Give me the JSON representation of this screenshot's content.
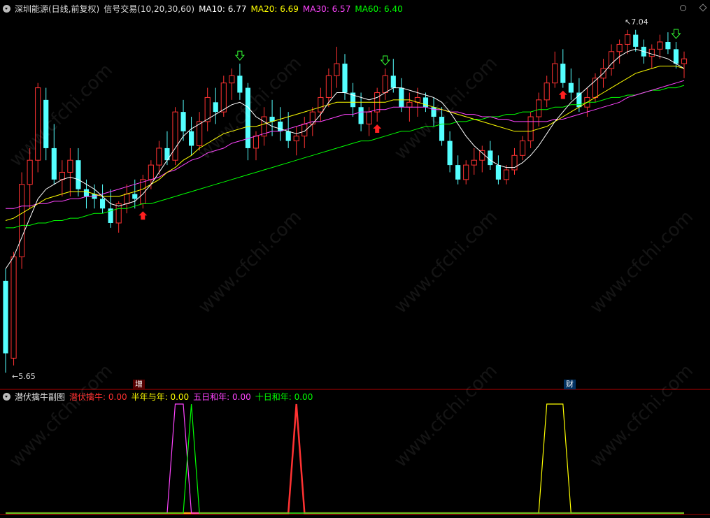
{
  "header": {
    "stock": "深圳能源(日线,前复权)",
    "indicator": "信号交易(10,20,30,60)",
    "ma": [
      {
        "label": "MA10: 6.77",
        "color": "#ffffff"
      },
      {
        "label": "MA20: 6.69",
        "color": "#ffff00"
      },
      {
        "label": "MA30: 6.57",
        "color": "#ff44ff"
      },
      {
        "label": "MA60: 6.40",
        "color": "#00ff00"
      }
    ]
  },
  "sub_header": {
    "name": "潜伏擒牛副图",
    "items": [
      {
        "label": "潜伏擒牛: 0.00",
        "color": "#ff3030"
      },
      {
        "label": "半年与年: 0.00",
        "color": "#ffff00"
      },
      {
        "label": "五日和年: 0.00",
        "color": "#ff44ff"
      },
      {
        "label": "十日和年: 0.00",
        "color": "#00ff00"
      }
    ]
  },
  "markers": {
    "high": "7.04",
    "low": "5.65",
    "tag_zeng": "增",
    "tag_cai": "财"
  },
  "watermark": "www.cfchi.com",
  "colors": {
    "up": "#ff3232",
    "down": "#54ffff",
    "ma10": "#ffffff",
    "ma20": "#ffff00",
    "ma30": "#ff44ff",
    "ma60": "#00ff00",
    "axis": "#b00000"
  },
  "chart_data": [
    {
      "type": "candlestick",
      "ylim": [
        5.6,
        7.1
      ],
      "candles": [
        [
          6.0,
          6.05,
          5.62,
          5.7
        ],
        [
          5.68,
          6.12,
          5.65,
          6.1
        ],
        [
          6.1,
          6.45,
          6.05,
          6.4
        ],
        [
          6.4,
          6.55,
          6.3,
          6.5
        ],
        [
          6.5,
          6.82,
          6.45,
          6.8
        ],
        [
          6.75,
          6.8,
          6.5,
          6.55
        ],
        [
          6.55,
          6.65,
          6.4,
          6.42
        ],
        [
          6.42,
          6.5,
          6.35,
          6.45
        ],
        [
          6.45,
          6.55,
          6.35,
          6.5
        ],
        [
          6.5,
          6.55,
          6.35,
          6.38
        ],
        [
          6.38,
          6.42,
          6.3,
          6.35
        ],
        [
          6.36,
          6.4,
          6.3,
          6.34
        ],
        [
          6.34,
          6.4,
          6.28,
          6.3
        ],
        [
          6.3,
          6.38,
          6.22,
          6.24
        ],
        [
          6.24,
          6.33,
          6.2,
          6.32
        ],
        [
          6.32,
          6.4,
          6.28,
          6.36
        ],
        [
          6.36,
          6.42,
          6.3,
          6.34
        ],
        [
          6.32,
          6.44,
          6.3,
          6.42
        ],
        [
          6.42,
          6.5,
          6.38,
          6.48
        ],
        [
          6.48,
          6.58,
          6.44,
          6.55
        ],
        [
          6.55,
          6.62,
          6.48,
          6.5
        ],
        [
          6.5,
          6.72,
          6.48,
          6.7
        ],
        [
          6.7,
          6.75,
          6.58,
          6.62
        ],
        [
          6.62,
          6.68,
          6.52,
          6.56
        ],
        [
          6.56,
          6.7,
          6.54,
          6.66
        ],
        [
          6.66,
          6.8,
          6.62,
          6.76
        ],
        [
          6.74,
          6.8,
          6.65,
          6.7
        ],
        [
          6.7,
          6.85,
          6.68,
          6.82
        ],
        [
          6.82,
          6.88,
          6.75,
          6.85
        ],
        [
          6.85,
          6.9,
          6.75,
          6.78
        ],
        [
          6.8,
          6.82,
          6.5,
          6.55
        ],
        [
          6.55,
          6.62,
          6.5,
          6.6
        ],
        [
          6.6,
          6.72,
          6.56,
          6.68
        ],
        [
          6.68,
          6.75,
          6.6,
          6.66
        ],
        [
          6.66,
          6.72,
          6.58,
          6.62
        ],
        [
          6.62,
          6.7,
          6.55,
          6.58
        ],
        [
          6.58,
          6.64,
          6.52,
          6.6
        ],
        [
          6.6,
          6.68,
          6.55,
          6.65
        ],
        [
          6.65,
          6.72,
          6.6,
          6.7
        ],
        [
          6.7,
          6.8,
          6.66,
          6.76
        ],
        [
          6.76,
          6.88,
          6.72,
          6.85
        ],
        [
          6.85,
          6.97,
          6.8,
          6.9
        ],
        [
          6.9,
          6.94,
          6.75,
          6.78
        ],
        [
          6.78,
          6.82,
          6.68,
          6.72
        ],
        [
          6.72,
          6.78,
          6.62,
          6.65
        ],
        [
          6.65,
          6.72,
          6.6,
          6.7
        ],
        [
          6.7,
          6.8,
          6.66,
          6.78
        ],
        [
          6.78,
          6.88,
          6.75,
          6.85
        ],
        [
          6.85,
          6.92,
          6.78,
          6.8
        ],
        [
          6.8,
          6.84,
          6.7,
          6.72
        ],
        [
          6.72,
          6.78,
          6.66,
          6.74
        ],
        [
          6.74,
          6.8,
          6.68,
          6.76
        ],
        [
          6.76,
          6.78,
          6.7,
          6.72
        ],
        [
          6.72,
          6.76,
          6.64,
          6.68
        ],
        [
          6.68,
          6.72,
          6.56,
          6.58
        ],
        [
          6.58,
          6.62,
          6.45,
          6.48
        ],
        [
          6.48,
          6.52,
          6.4,
          6.42
        ],
        [
          6.42,
          6.5,
          6.4,
          6.48
        ],
        [
          6.48,
          6.55,
          6.44,
          6.5
        ],
        [
          6.5,
          6.56,
          6.45,
          6.54
        ],
        [
          6.54,
          6.58,
          6.46,
          6.48
        ],
        [
          6.48,
          6.52,
          6.4,
          6.42
        ],
        [
          6.42,
          6.48,
          6.4,
          6.46
        ],
        [
          6.46,
          6.55,
          6.44,
          6.52
        ],
        [
          6.52,
          6.6,
          6.5,
          6.58
        ],
        [
          6.58,
          6.7,
          6.55,
          6.68
        ],
        [
          6.68,
          6.78,
          6.64,
          6.75
        ],
        [
          6.75,
          6.85,
          6.72,
          6.82
        ],
        [
          6.82,
          6.95,
          6.8,
          6.9
        ],
        [
          6.9,
          6.96,
          6.8,
          6.82
        ],
        [
          6.82,
          6.88,
          6.75,
          6.78
        ],
        [
          6.78,
          6.84,
          6.7,
          6.72
        ],
        [
          6.72,
          6.8,
          6.68,
          6.76
        ],
        [
          6.76,
          6.86,
          6.74,
          6.84
        ],
        [
          6.84,
          6.92,
          6.8,
          6.88
        ],
        [
          6.88,
          6.98,
          6.85,
          6.95
        ],
        [
          6.95,
          7.0,
          6.9,
          6.98
        ],
        [
          6.98,
          7.04,
          6.94,
          7.02
        ],
        [
          7.02,
          7.04,
          6.95,
          6.97
        ],
        [
          6.97,
          7.0,
          6.9,
          6.93
        ],
        [
          6.93,
          6.98,
          6.88,
          6.96
        ],
        [
          6.96,
          7.02,
          6.92,
          6.99
        ],
        [
          6.99,
          7.03,
          6.94,
          6.96
        ],
        [
          6.96,
          6.99,
          6.88,
          6.9
        ],
        [
          6.9,
          6.95,
          6.84,
          6.92
        ]
      ],
      "ma10": [
        6.05,
        6.1,
        6.18,
        6.26,
        6.34,
        6.38,
        6.4,
        6.42,
        6.43,
        6.42,
        6.4,
        6.38,
        6.35,
        6.32,
        6.31,
        6.32,
        6.33,
        6.36,
        6.4,
        6.45,
        6.5,
        6.55,
        6.6,
        6.63,
        6.65,
        6.67,
        6.69,
        6.71,
        6.73,
        6.74,
        6.72,
        6.68,
        6.66,
        6.64,
        6.63,
        6.62,
        6.61,
        6.62,
        6.65,
        6.69,
        6.74,
        6.78,
        6.78,
        6.77,
        6.76,
        6.75,
        6.76,
        6.78,
        6.8,
        6.8,
        6.79,
        6.78,
        6.77,
        6.76,
        6.74,
        6.7,
        6.65,
        6.6,
        6.56,
        6.53,
        6.5,
        6.48,
        6.47,
        6.47,
        6.49,
        6.52,
        6.56,
        6.61,
        6.66,
        6.7,
        6.74,
        6.77,
        6.8,
        6.83,
        6.86,
        6.9,
        6.93,
        6.95,
        6.96,
        6.95,
        6.94,
        6.93,
        6.92,
        6.9,
        6.88
      ],
      "ma20": [
        6.25,
        6.26,
        6.28,
        6.3,
        6.32,
        6.34,
        6.35,
        6.36,
        6.37,
        6.37,
        6.37,
        6.36,
        6.35,
        6.35,
        6.35,
        6.36,
        6.37,
        6.38,
        6.4,
        6.42,
        6.45,
        6.47,
        6.5,
        6.52,
        6.55,
        6.57,
        6.59,
        6.61,
        6.62,
        6.63,
        6.64,
        6.64,
        6.65,
        6.66,
        6.67,
        6.68,
        6.69,
        6.7,
        6.71,
        6.72,
        6.73,
        6.74,
        6.74,
        6.74,
        6.74,
        6.74,
        6.74,
        6.74,
        6.75,
        6.75,
        6.75,
        6.74,
        6.73,
        6.72,
        6.71,
        6.7,
        6.69,
        6.68,
        6.67,
        6.66,
        6.65,
        6.64,
        6.63,
        6.62,
        6.62,
        6.62,
        6.63,
        6.64,
        6.66,
        6.68,
        6.7,
        6.72,
        6.74,
        6.76,
        6.78,
        6.8,
        6.82,
        6.84,
        6.86,
        6.87,
        6.88,
        6.89,
        6.89,
        6.89,
        6.88
      ],
      "ma30": [
        6.3,
        6.3,
        6.31,
        6.31,
        6.32,
        6.32,
        6.33,
        6.33,
        6.34,
        6.34,
        6.35,
        6.35,
        6.36,
        6.37,
        6.38,
        6.39,
        6.4,
        6.41,
        6.42,
        6.43,
        6.45,
        6.46,
        6.48,
        6.5,
        6.51,
        6.53,
        6.54,
        6.55,
        6.57,
        6.58,
        6.59,
        6.6,
        6.61,
        6.62,
        6.62,
        6.63,
        6.64,
        6.65,
        6.66,
        6.66,
        6.67,
        6.68,
        6.69,
        6.69,
        6.7,
        6.7,
        6.71,
        6.71,
        6.72,
        6.72,
        6.72,
        6.72,
        6.72,
        6.71,
        6.71,
        6.7,
        6.7,
        6.69,
        6.69,
        6.68,
        6.68,
        6.67,
        6.67,
        6.66,
        6.66,
        6.66,
        6.66,
        6.66,
        6.67,
        6.67,
        6.68,
        6.69,
        6.7,
        6.71,
        6.72,
        6.73,
        6.74,
        6.76,
        6.77,
        6.78,
        6.79,
        6.8,
        6.81,
        6.82,
        6.83
      ],
      "ma60": [
        6.22,
        6.22,
        6.23,
        6.23,
        6.24,
        6.24,
        6.25,
        6.25,
        6.26,
        6.26,
        6.27,
        6.28,
        6.28,
        6.29,
        6.3,
        6.3,
        6.31,
        6.32,
        6.32,
        6.33,
        6.34,
        6.35,
        6.36,
        6.37,
        6.38,
        6.39,
        6.4,
        6.41,
        6.42,
        6.43,
        6.44,
        6.45,
        6.46,
        6.47,
        6.48,
        6.49,
        6.5,
        6.51,
        6.52,
        6.53,
        6.54,
        6.55,
        6.56,
        6.57,
        6.58,
        6.58,
        6.59,
        6.6,
        6.61,
        6.62,
        6.62,
        6.63,
        6.64,
        6.64,
        6.65,
        6.65,
        6.66,
        6.66,
        6.67,
        6.67,
        6.68,
        6.68,
        6.69,
        6.69,
        6.7,
        6.7,
        6.71,
        6.71,
        6.72,
        6.72,
        6.73,
        6.73,
        6.74,
        6.74,
        6.75,
        6.76,
        6.76,
        6.77,
        6.77,
        6.78,
        6.79,
        6.79,
        6.8,
        6.8,
        6.81
      ],
      "signals": [
        {
          "index": 17,
          "type": "buy"
        },
        {
          "index": 29,
          "type": "sell"
        },
        {
          "index": 46,
          "type": "buy"
        },
        {
          "index": 47,
          "type": "sell"
        },
        {
          "index": 69,
          "type": "buy"
        },
        {
          "index": 83,
          "type": "sell"
        }
      ]
    },
    {
      "type": "line",
      "ylim": [
        0,
        1
      ],
      "series": [
        {
          "name": "潜伏擒牛",
          "values": [
            [
              0,
              0
            ],
            [
              35,
              0
            ],
            [
              36,
              1
            ],
            [
              37,
              0
            ],
            [
              84,
              0
            ]
          ]
        },
        {
          "name": "半年与年",
          "values": [
            [
              0,
              0
            ],
            [
              66,
              0
            ],
            [
              67,
              1
            ],
            [
              69,
              1
            ],
            [
              70,
              0
            ],
            [
              84,
              0
            ]
          ]
        },
        {
          "name": "五日和年",
          "values": [
            [
              0,
              0
            ],
            [
              20,
              0
            ],
            [
              21,
              1
            ],
            [
              22,
              1
            ],
            [
              23,
              0
            ],
            [
              84,
              0
            ]
          ]
        },
        {
          "name": "十日和年",
          "values": [
            [
              0,
              0
            ],
            [
              22,
              0
            ],
            [
              23,
              1
            ],
            [
              24,
              0
            ],
            [
              84,
              0
            ]
          ]
        }
      ]
    }
  ]
}
